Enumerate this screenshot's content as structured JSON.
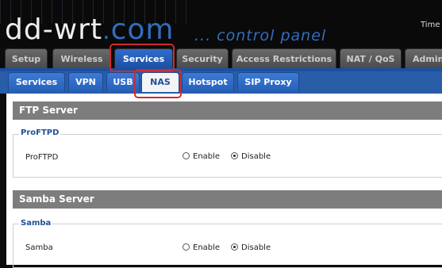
{
  "header": {
    "logo_main": "dd-wrt",
    "logo_dot": ".",
    "logo_com": "com",
    "subtitle": "... control panel",
    "time_label": "Time"
  },
  "main_tabs": [
    {
      "label": "Setup"
    },
    {
      "label": "Wireless"
    },
    {
      "label": "Services",
      "active": true
    },
    {
      "label": "Security"
    },
    {
      "label": "Access Restrictions"
    },
    {
      "label": "NAT / QoS"
    },
    {
      "label": "Admini"
    }
  ],
  "sub_tabs": [
    {
      "label": "Services"
    },
    {
      "label": "VPN"
    },
    {
      "label": "USB"
    },
    {
      "label": "NAS",
      "active": true
    },
    {
      "label": "Hotspot"
    },
    {
      "label": "SIP Proxy"
    }
  ],
  "sections": {
    "ftp": {
      "title": "FTP Server",
      "legend": "ProFTPD",
      "row_label": "ProFTPD",
      "enable_label": "Enable",
      "disable_label": "Disable",
      "selected": "Disable"
    },
    "samba": {
      "title": "Samba Server",
      "legend": "Samba",
      "row_label": "Samba",
      "enable_label": "Enable",
      "disable_label": "Disable",
      "selected": "Disable"
    }
  },
  "colors": {
    "active_tab": "#2f6ccc",
    "highlight": "#d02a32",
    "section_header": "#7d7d7d"
  }
}
